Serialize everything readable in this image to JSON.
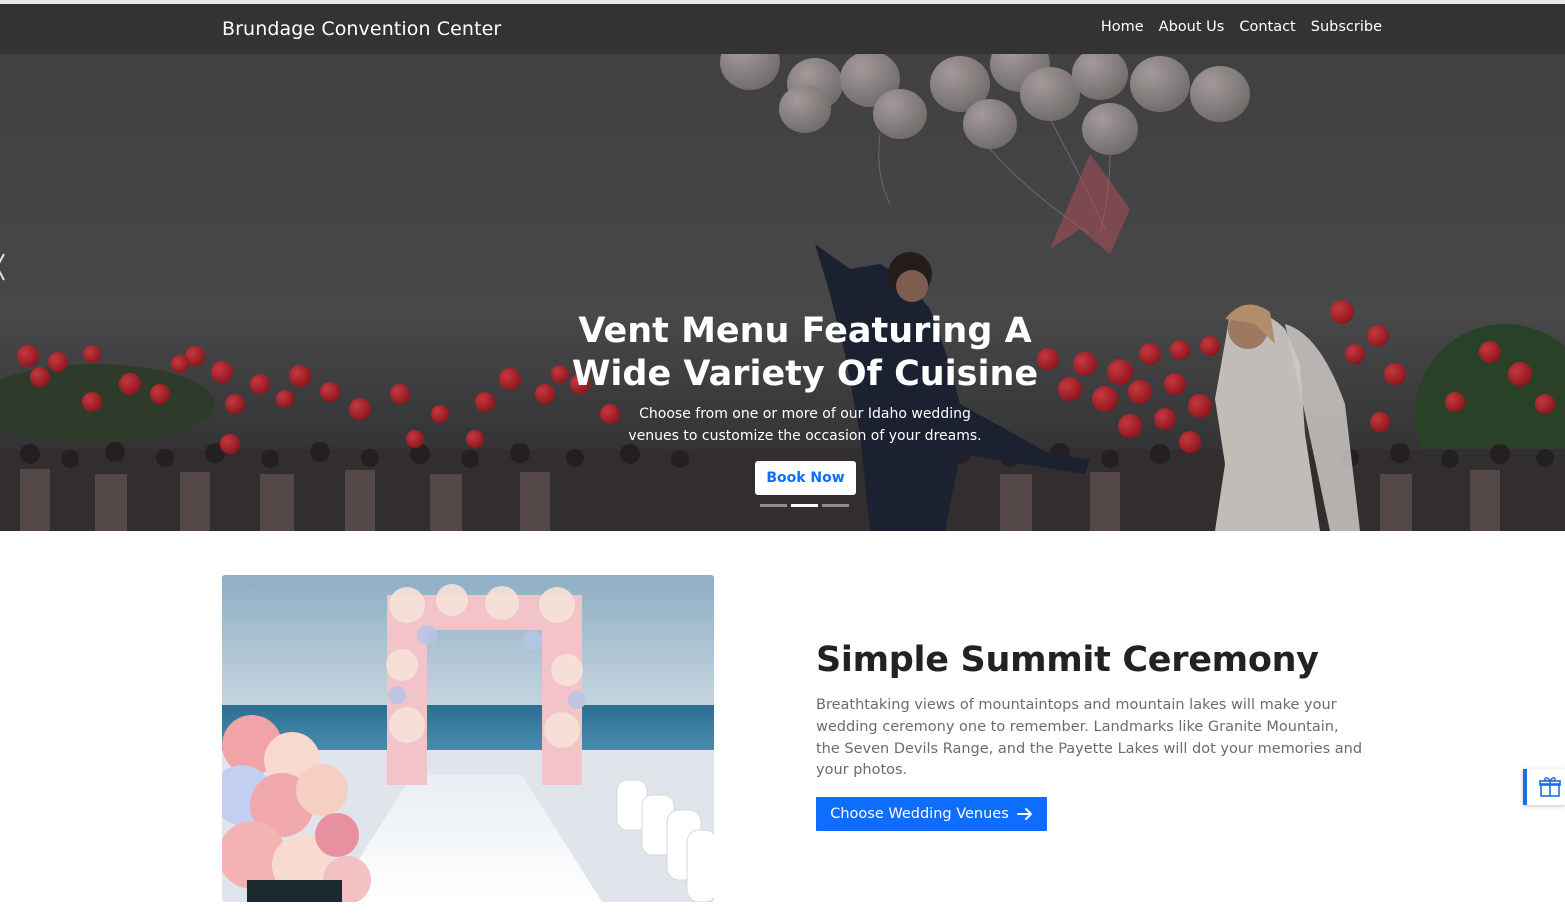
{
  "nav": {
    "brand": "Brundage Convention Center",
    "links": [
      "Home",
      "About Us",
      "Contact",
      "Subscribe"
    ]
  },
  "hero": {
    "title_lines": [
      "Vent Menu Featuring A",
      "Wide Variety Of Cuisine"
    ],
    "subtitle_lines": [
      "Choose from one or more of our Idaho wedding",
      "venues to customize the occasion of your dreams."
    ],
    "book_label": "Book Now",
    "slide_count": 3,
    "active_slide": 2
  },
  "feature": {
    "title": "Simple Summit Ceremony",
    "text": "Breathtaking views of mountaintops and mountain lakes will make your wedding ceremony one to remember. Landmarks like Granite Mountain, the Seven Devils Range, and the Payette Lakes will dot your memories and your photos.",
    "button_label": "Choose Wedding Venues"
  },
  "colors": {
    "navbar": "#333333",
    "primary": "#0d6efd",
    "heading": "#222222",
    "body_text": "#6c6c6c"
  },
  "icons": {
    "carousel_prev": "chevron-left-icon",
    "button_arrow": "arrow-right-icon",
    "widget": "gift-icon"
  }
}
